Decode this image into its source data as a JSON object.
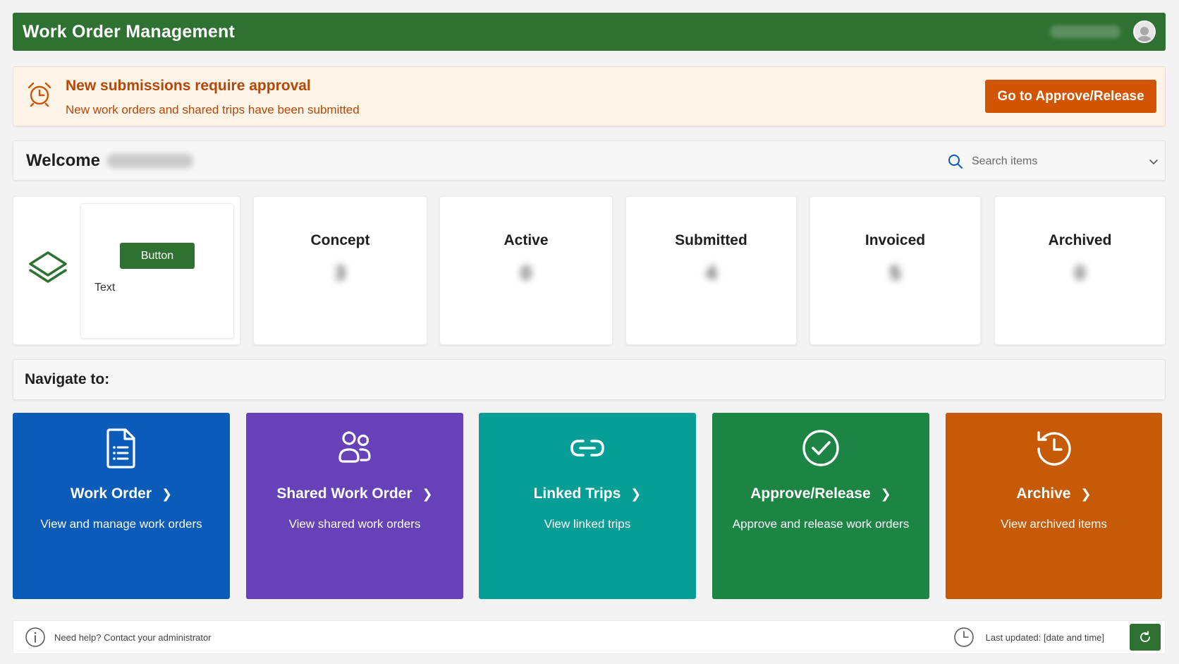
{
  "header": {
    "title": "Work Order Management",
    "user_name": "",
    "avatar_icon": "user-avatar-icon",
    "color": "#2f7133"
  },
  "banner": {
    "icon": "alarm-clock-icon",
    "title": "New submissions require approval",
    "subtitle": "New work orders and shared trips have been submitted",
    "button_label": "Go to Approve/Release",
    "color": "#d35400"
  },
  "welcome": {
    "label": "Welcome",
    "search_placeholder": "Search items",
    "search_icon": "search-icon",
    "dropdown_icon": "chevron-down-icon"
  },
  "status_panel": {
    "icon": "layers-icon",
    "button_label": "Button",
    "text": "Text",
    "cards": [
      {
        "label": "Concept",
        "count": "3"
      },
      {
        "label": "Active",
        "count": "0"
      },
      {
        "label": "Submitted",
        "count": "4"
      },
      {
        "label": "Invoiced",
        "count": "5"
      },
      {
        "label": "Archived",
        "count": "0"
      }
    ]
  },
  "navigate": {
    "label": "Navigate to:",
    "tiles": [
      {
        "title": "Work Order",
        "description": "View and manage work orders",
        "icon": "document-list-icon",
        "color": "#0a5cb8"
      },
      {
        "title": "Shared Work Order",
        "description": "View shared work orders",
        "icon": "people-icon",
        "color": "#6741b8"
      },
      {
        "title": "Linked Trips",
        "description": "View linked trips",
        "icon": "link-icon",
        "color": "#079e96"
      },
      {
        "title": "Approve/Release",
        "description": "Approve and release work orders",
        "icon": "check-circle-icon",
        "color": "#1d8543"
      },
      {
        "title": "Archive",
        "description": "View archived items",
        "icon": "history-icon",
        "color": "#c65a07"
      }
    ]
  },
  "footer": {
    "help_text": "Need help? Contact your administrator",
    "help_icon": "info-icon",
    "updated_text": "Last updated: [date and time]",
    "clock_icon": "clock-icon",
    "refresh_icon": "refresh-icon"
  }
}
